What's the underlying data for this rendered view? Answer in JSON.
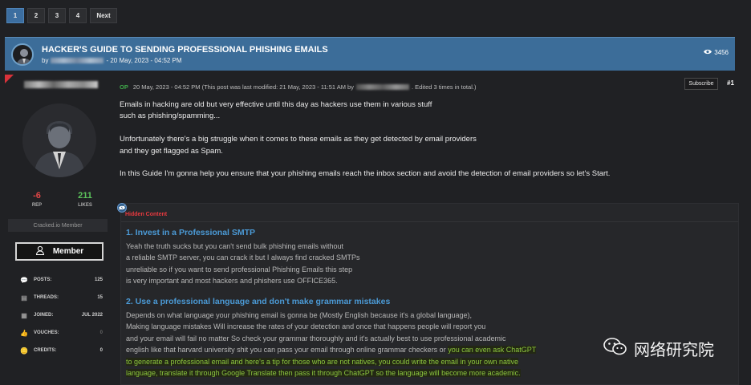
{
  "pagination": {
    "pages": [
      "1",
      "2",
      "3",
      "4"
    ],
    "active": "1",
    "next_label": "Next"
  },
  "thread": {
    "title": "HACKER'S GUIDE TO SENDING PROFESSIONAL PHISHING EMAILS",
    "by_label": "by",
    "date": "- 20 May, 2023 - 04:52 PM",
    "views": "3456"
  },
  "author": {
    "reputation": "-6",
    "reputation_label": "REP",
    "likes": "211",
    "likes_label": "LIKES",
    "usergroup": "Cracked.io Member",
    "badge": "Member",
    "stats": [
      {
        "icon": "posts-icon",
        "label": "POSTS:",
        "value": "125"
      },
      {
        "icon": "threads-icon",
        "label": "THREADS:",
        "value": "15"
      },
      {
        "icon": "joined-icon",
        "label": "JOINED:",
        "value": "JUL 2022"
      },
      {
        "icon": "vouches-icon",
        "label": "VOUCHES:",
        "value": "0"
      },
      {
        "icon": "credits-icon",
        "label": "CREDITS:",
        "value": "0"
      }
    ]
  },
  "post": {
    "op_tag": "OP",
    "meta_prefix": "20 May, 2023 - 04:52 PM (This post was last modified: 21 May, 2023 - 11:51 AM by",
    "meta_suffix": ". Edited 3 times in total.)",
    "subscribe_label": "Subscribe",
    "post_number": "#1",
    "paragraphs": [
      [
        "Emails in hacking are old but very effective until this day as hackers use them in various stuff",
        "such as phishing/spamming..."
      ],
      [
        "Unfortunately there's a big struggle when it comes to these emails as they get detected by email providers",
        "and they get flagged as Spam."
      ],
      [
        "In this Guide I'm gonna help you ensure that your phishing emails reach the inbox section and avoid the detection of email providers so let's Start."
      ]
    ],
    "hidden_label": "Hidden Content",
    "sections": [
      {
        "heading": "1. Invest in a Professional SMTP",
        "lines": [
          "Yeah the truth sucks but you can't send bulk phishing emails without",
          "a reliable SMTP server, you can crack it but I always find cracked SMTPs",
          "unreliable so if you want to send professional Phishing Emails this step",
          "is very important and most hackers and phishers use OFFICE365."
        ]
      },
      {
        "heading": "2. Use a professional language and don't make grammar mistakes",
        "lines": [
          "Depends on what language your phishing email is gonna be (Mostly English because it's a global language),",
          "Making language mistakes Will increase the rates of your detection and once that happens people will report you",
          "and your email will fail no matter So check your grammar thoroughly and it's actually best to use professional academic"
        ],
        "mixed_line_plain": "english like that harvard university shit you can pass your email through online grammar checkers or ",
        "mixed_line_highlight": "you can even ask ChatGPT",
        "highlight_lines": [
          "to generate a professional email and here's a tip for those who are not natives, you could write the email in your own native",
          "language, translate it through Google Translate then pass it through ChatGPT so the language will become more academic."
        ]
      }
    ]
  },
  "watermark": {
    "text": "网络研究院"
  },
  "colors": {
    "accent_blue": "#3c6d99",
    "rep_negative": "#e04646",
    "likes_positive": "#5bc35b",
    "op_green": "#3fa84a",
    "heading_blue": "#4b9ad6",
    "hidden_red": "#e8393f",
    "highlight_green": "#8cc63f"
  }
}
